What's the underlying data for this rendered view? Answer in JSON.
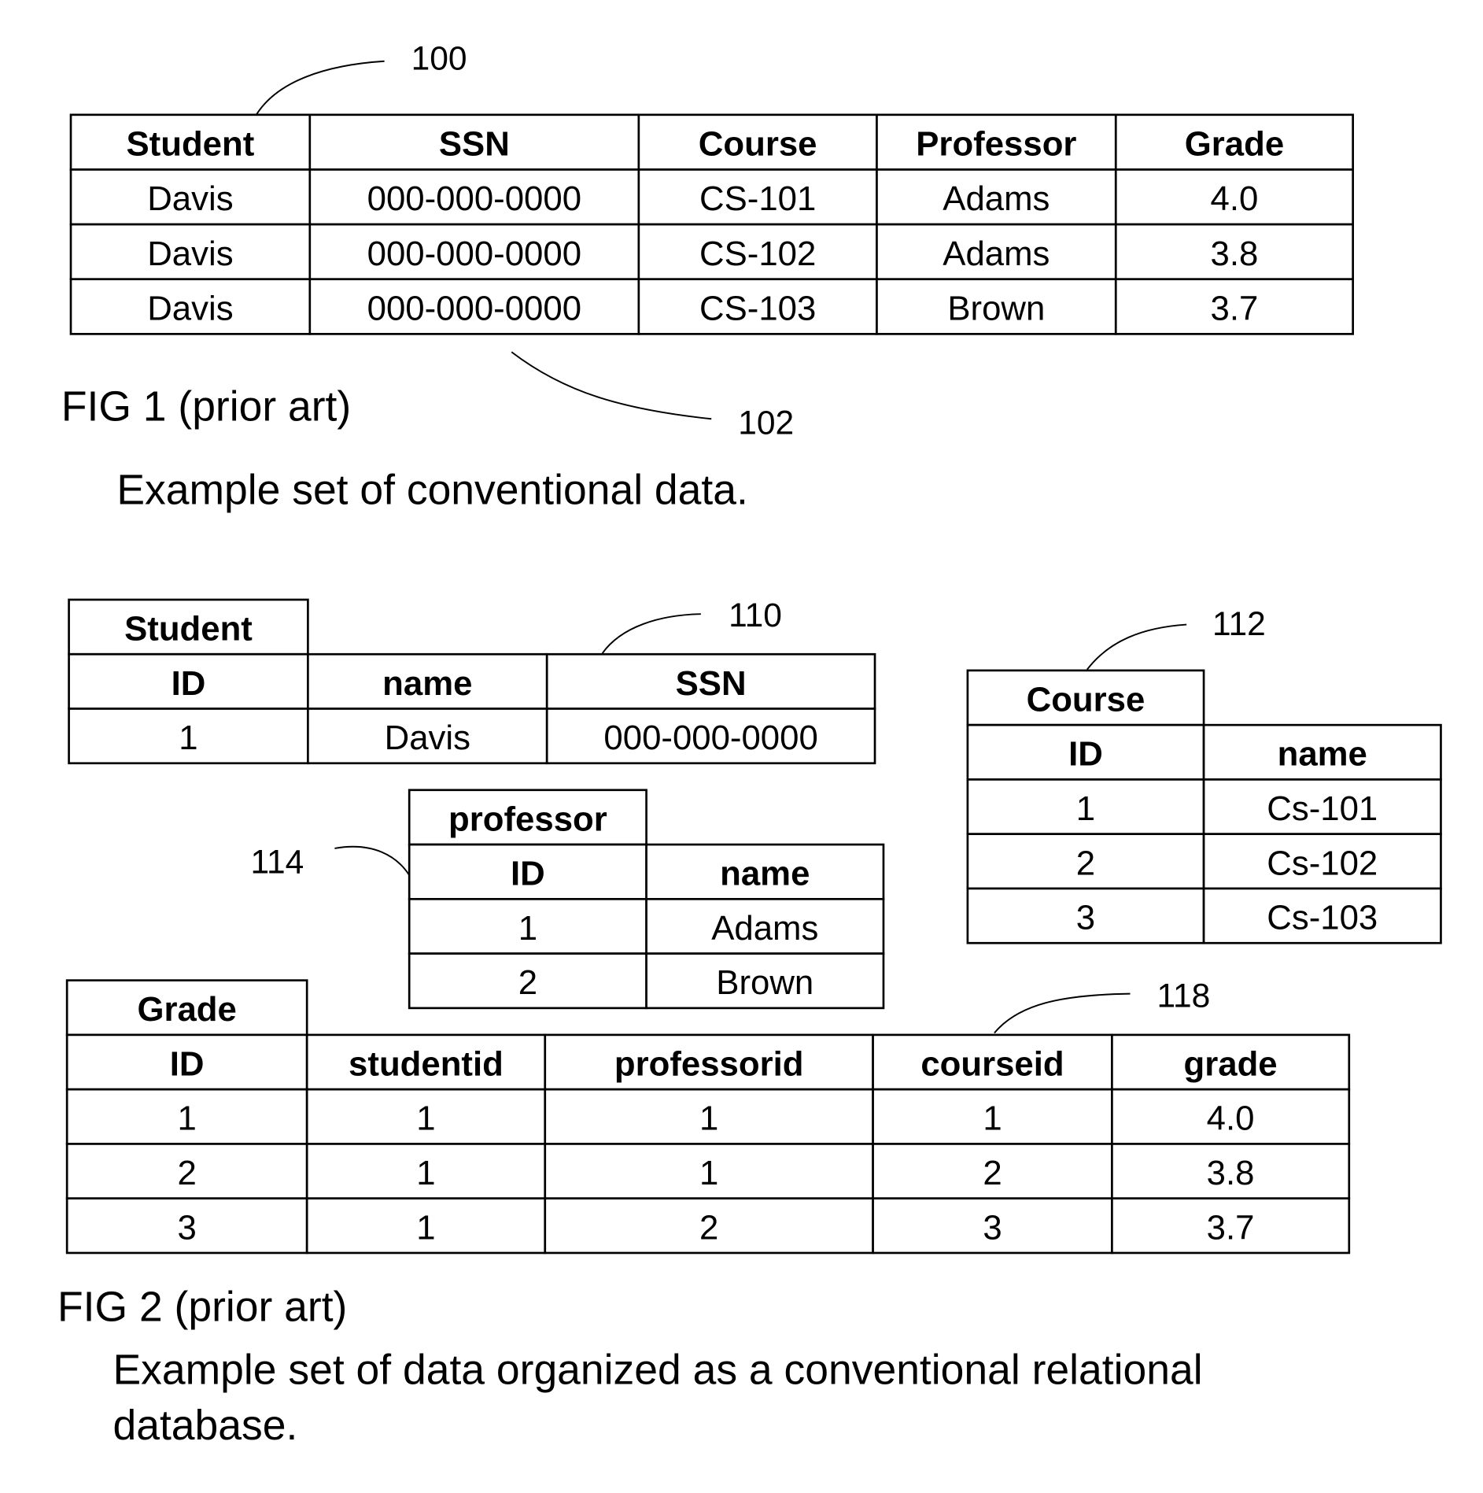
{
  "fig1": {
    "ref_table": "100",
    "ref_rows": "102",
    "caption": "FIG 1 (prior art)",
    "description": "Example set of conventional data.",
    "table": {
      "headers": [
        "Student",
        "SSN",
        "Course",
        "Professor",
        "Grade"
      ],
      "rows": [
        [
          "Davis",
          "000-000-0000",
          "CS-101",
          "Adams",
          "4.0"
        ],
        [
          "Davis",
          "000-000-0000",
          "CS-102",
          "Adams",
          "3.8"
        ],
        [
          "Davis",
          "000-000-0000",
          "CS-103",
          "Brown",
          "3.7"
        ]
      ]
    }
  },
  "fig2": {
    "caption": "FIG 2 (prior art)",
    "description_line1": "Example set of data organized as a conventional relational",
    "description_line2": "database.",
    "student": {
      "ref": "110",
      "title": "Student",
      "headers": [
        "ID",
        "name",
        "SSN"
      ],
      "rows": [
        [
          "1",
          "Davis",
          "000-000-0000"
        ]
      ]
    },
    "course": {
      "ref": "112",
      "title": "Course",
      "headers": [
        "ID",
        "name"
      ],
      "rows": [
        [
          "1",
          "Cs-101"
        ],
        [
          "2",
          "Cs-102"
        ],
        [
          "3",
          "Cs-103"
        ]
      ]
    },
    "professor": {
      "ref": "114",
      "title": "professor",
      "headers": [
        "ID",
        "name"
      ],
      "rows": [
        [
          "1",
          "Adams"
        ],
        [
          "2",
          "Brown"
        ]
      ]
    },
    "grade": {
      "ref": "118",
      "title": "Grade",
      "headers": [
        "ID",
        "studentid",
        "professorid",
        "courseid",
        "grade"
      ],
      "rows": [
        [
          "1",
          "1",
          "1",
          "1",
          "4.0"
        ],
        [
          "2",
          "1",
          "1",
          "2",
          "3.8"
        ],
        [
          "3",
          "1",
          "2",
          "3",
          "3.7"
        ]
      ]
    }
  }
}
